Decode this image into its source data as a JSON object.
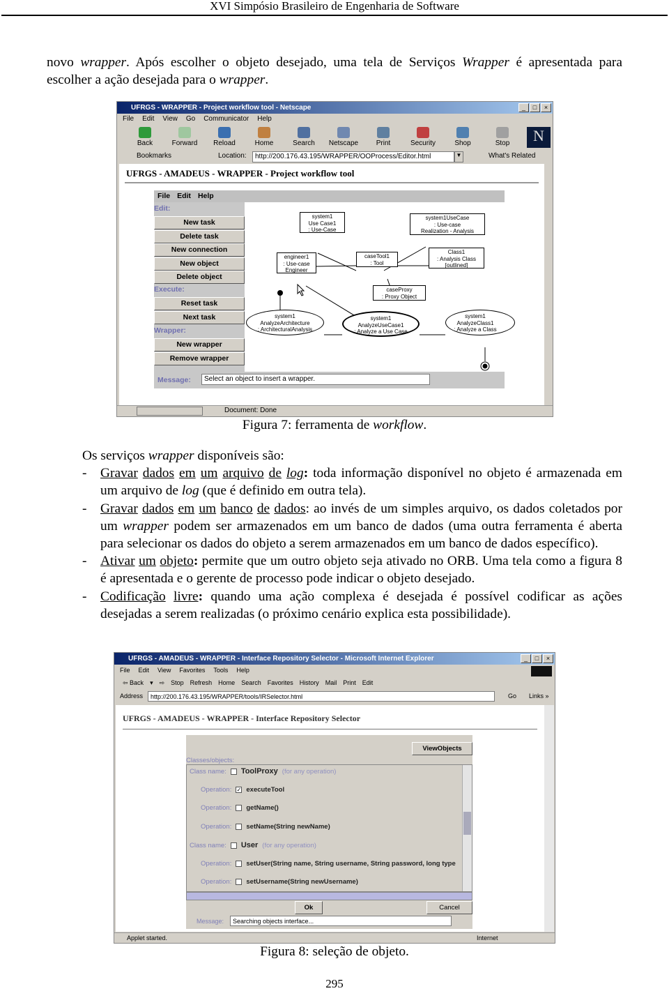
{
  "running_header": "XVI Simpósio Brasileiro de Engenharia de Software",
  "para1": {
    "w1": "novo ",
    "i1": "wrapper",
    "t1": ". Após escolher o objeto desejado, uma tela de Serviços ",
    "i2": "Wrapper",
    "t2": " é apresentada para escolher a ação desejada para o ",
    "i3": "wrapper",
    "t3": "."
  },
  "figure7": {
    "window_title": "UFRGS - WRAPPER - Project workflow tool - Netscape",
    "window_buttons": [
      "_",
      "□",
      "×"
    ],
    "menu": [
      "File",
      "Edit",
      "View",
      "Go",
      "Communicator",
      "Help"
    ],
    "toolbar": [
      {
        "label": "Back",
        "icon": "back-arrow-icon",
        "color": "#2e9a3a"
      },
      {
        "label": "Forward",
        "icon": "forward-arrow-icon",
        "color": "#9fc79f"
      },
      {
        "label": "Reload",
        "icon": "reload-icon",
        "color": "#3a6fb0"
      },
      {
        "label": "Home",
        "icon": "home-icon",
        "color": "#c08040"
      },
      {
        "label": "Search",
        "icon": "search-icon",
        "color": "#5070a0"
      },
      {
        "label": "Netscape",
        "icon": "netscape-icon",
        "color": "#7088b0"
      },
      {
        "label": "Print",
        "icon": "print-icon",
        "color": "#6080a0"
      },
      {
        "label": "Security",
        "icon": "lock-icon",
        "color": "#c04040"
      },
      {
        "label": "Shop",
        "icon": "shop-icon",
        "color": "#5080b0"
      },
      {
        "label": "Stop",
        "icon": "stop-icon",
        "color": "#a0a0a0"
      }
    ],
    "bookmarks": "Bookmarks",
    "location_label": "Location:",
    "location_url": "http://200.176.43.195/WRAPPER/OOProcess/Editor.html",
    "whats_related": "What's Related",
    "page_title": "UFRGS - AMADEUS - WRAPPER - Project workflow tool",
    "applet_menu": [
      "File",
      "Edit",
      "Help"
    ],
    "groups": {
      "edit": "Edit:",
      "execute": "Execute:",
      "wrapper": "Wrapper:"
    },
    "edit_buttons": [
      "New task",
      "Delete task",
      "New connection",
      "New object",
      "Delete object"
    ],
    "execute_buttons": [
      "Reset task",
      "Next task"
    ],
    "wrapper_buttons": [
      "New wrapper",
      "Remove wrapper"
    ],
    "message_label": "Message:",
    "message_value": "Select an object to insert a wrapper.",
    "status": "Document: Done",
    "diagram": {
      "usecase1": [
        "system1",
        "Use Case1",
        ": Use-Case"
      ],
      "realization": [
        "system1UseCase",
        ": Use-case",
        "Realization - Analysis"
      ],
      "engineer": [
        "engineer1",
        ": Use-case",
        "Engineer"
      ],
      "casetool": [
        "caseTool1",
        ": Tool"
      ],
      "class1": [
        "Class1",
        ": Analysis Class",
        "[outlined]"
      ],
      "caseproxy": [
        "caseProxy",
        ": Proxy Object"
      ],
      "arch": [
        "system1",
        "AnalyzeArchitecture",
        ": ArchitecturalAnalysis"
      ],
      "analyzeuc": [
        "system1",
        "AnalyzeUseCase1",
        ": Analyze a Use Case"
      ],
      "analyzeclass": [
        "system1",
        "AnalyzeClass1",
        ": Analyze a Class"
      ]
    },
    "caption_prefix": "Figura 7: ferramenta de ",
    "caption_italic": "workflow",
    "caption_suffix": "."
  },
  "services": {
    "intro_a": "Os serviços ",
    "intro_i": "wrapper",
    "intro_b": " disponíveis são:",
    "dash": "-",
    "item1": {
      "words": [
        "Gravar",
        "dados",
        "em",
        "um",
        "arquivo",
        "de"
      ],
      "italic_word": "log",
      "colon": ":",
      "a": " toda informação disponível no objeto é armazenada em um arquivo de ",
      "i": "log",
      "b": " (que é definido em outra tela)."
    },
    "item2": {
      "words": [
        "Gravar",
        "dados",
        "em",
        "um",
        "banco",
        "de",
        "dados"
      ],
      "a": ": ao invés de um simples arquivo, os dados coletados por um ",
      "i": "wrapper",
      "b": " podem ser armazenados em um banco de dados (uma outra ferramenta é aberta para selecionar os dados do objeto a serem armazenados em um banco de dados específico)."
    },
    "item3": {
      "words": [
        "Ativar",
        "um",
        "objeto"
      ],
      "colon": ":",
      "a": " permite que um outro objeto seja ativado no ORB. Uma tela como a figura 8 é apresentada e o gerente de processo pode indicar o objeto desejado."
    },
    "item4": {
      "words": [
        "Codificação",
        "livre"
      ],
      "colon": ":",
      "a": " quando uma ação complexa é desejada é possível codificar as ações desejadas a serem realizadas (o próximo cenário explica esta possibilidade)."
    }
  },
  "figure8": {
    "window_title": "UFRGS - AMADEUS - WRAPPER - Interface Repository Selector - Microsoft Internet Explorer",
    "window_buttons": [
      "_",
      "□",
      "×"
    ],
    "menu": [
      "File",
      "Edit",
      "View",
      "Favorites",
      "Tools",
      "Help"
    ],
    "toolbar": [
      "⇦ Back",
      "▾",
      "⇨",
      "Stop",
      "Refresh",
      "Home",
      "Search",
      "Favorites",
      "History",
      "Mail",
      "Print",
      "Edit"
    ],
    "address_label": "Address",
    "address_url": "http://200.176.43.195/WRAPPER/tools/IRSelector.html",
    "go": "Go",
    "links": "Links »",
    "page_title": "UFRGS - AMADEUS - WRAPPER - Interface Repository Selector",
    "view_objects": "ViewObjects",
    "classes_label": "Classes/objects:",
    "rows": [
      {
        "label": "Class name:",
        "checked": false,
        "name": "ToolProxy",
        "hint": "(for any operation)",
        "indent": false
      },
      {
        "label": "Operation:",
        "checked": true,
        "name": "executeTool",
        "hint": "",
        "indent": true
      },
      {
        "label": "Operation:",
        "checked": false,
        "name": "getName()",
        "hint": "",
        "indent": true
      },
      {
        "label": "Operation:",
        "checked": false,
        "name": "setName(String newName)",
        "hint": "",
        "indent": true
      },
      {
        "label": "Class name:",
        "checked": false,
        "name": "User",
        "hint": "(for any operation)",
        "indent": false
      },
      {
        "label": "Operation:",
        "checked": false,
        "name": "setUser(String name, String username, String password, long type",
        "hint": "",
        "indent": true
      },
      {
        "label": "Operation:",
        "checked": false,
        "name": "setUsername(String newUsername)",
        "hint": "",
        "indent": true
      }
    ],
    "ok": "Ok",
    "cancel": "Cancel",
    "message_label": "Message:",
    "message_value": "Searching objects interface...",
    "status_left": "Applet started.",
    "status_right": "Internet",
    "caption": "Figura 8: seleção de objeto."
  },
  "page_number": "295"
}
